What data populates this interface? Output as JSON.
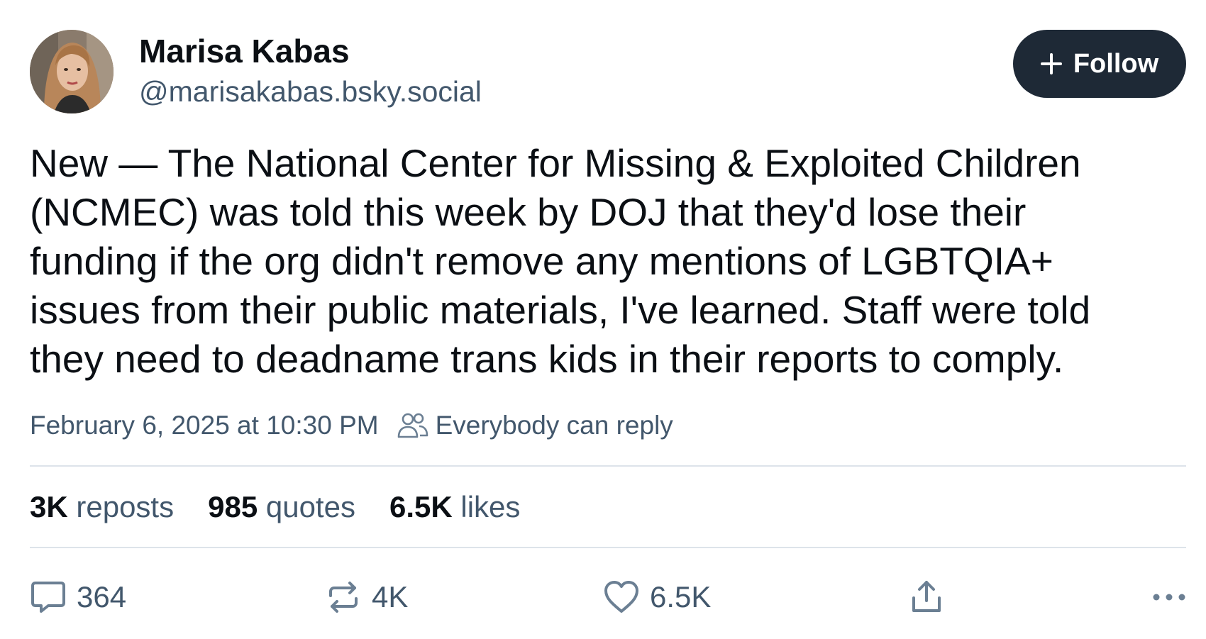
{
  "author": {
    "display_name": "Marisa Kabas",
    "handle": "@marisakabas.bsky.social",
    "avatar_icon": "avatar-photo"
  },
  "follow_button": {
    "label": "Follow",
    "icon": "plus-icon",
    "color": "#1e2936"
  },
  "post": {
    "text": "New — The National Center for Missing & Exploited Children (NCMEC) was told this week by DOJ that they'd lose their funding if the org didn't remove any mentions of LGBTQIA+ issues from their public materials, I've learned. Staff were told they need to deadname trans kids in their reports to comply.",
    "timestamp": "February 6, 2025 at 10:30 PM",
    "reply_setting": {
      "icon": "people-icon",
      "label": "Everybody can reply"
    }
  },
  "stats": {
    "reposts": {
      "count": "3K",
      "label": "reposts"
    },
    "quotes": {
      "count": "985",
      "label": "quotes"
    },
    "likes": {
      "count": "6.5K",
      "label": "likes"
    }
  },
  "actions": {
    "reply": {
      "icon": "comment-icon",
      "count": "364"
    },
    "repost": {
      "icon": "repost-icon",
      "count": "4K"
    },
    "like": {
      "icon": "heart-icon",
      "count": "6.5K"
    },
    "share": {
      "icon": "share-icon"
    },
    "more": {
      "icon": "more-icon"
    }
  },
  "colors": {
    "text_primary": "#0b0f14",
    "text_secondary": "#42576c",
    "divider": "#dde3ea"
  }
}
